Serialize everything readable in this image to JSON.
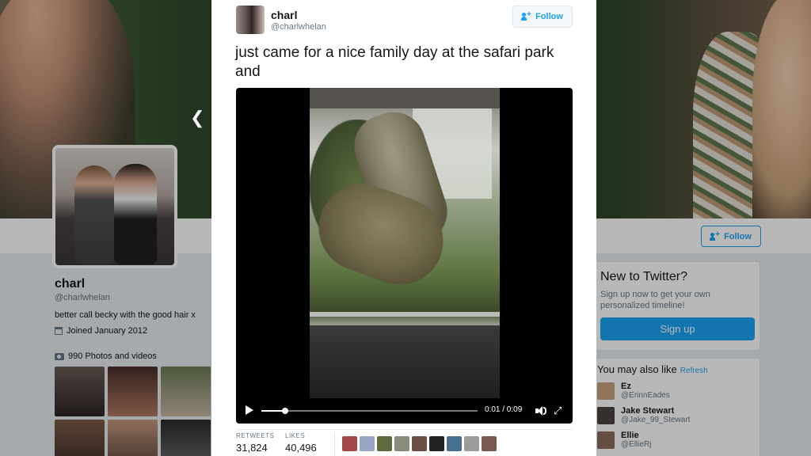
{
  "profile": {
    "name": "charl",
    "handle": "@charlwhelan",
    "bio": "better call becky with the good hair x",
    "joined": "Joined January 2012",
    "photos": "990 Photos and videos",
    "follow_label": "Follow"
  },
  "sidebar": {
    "new_title": "New to Twitter?",
    "new_subtitle": "Sign up now to get your own personalized timeline!",
    "signup_label": "Sign up",
    "wtf_title": "You may also like",
    "refresh_label": "Refresh",
    "users": [
      {
        "name": "Ez",
        "handle": "@ErinnEades",
        "color": "#c9a27a"
      },
      {
        "name": "Jake Stewart",
        "handle": "@Jake_99_Stewart",
        "color": "#4b4541"
      },
      {
        "name": "Ellie",
        "handle": "@EllieRj",
        "color": "#8b6c5c"
      }
    ]
  },
  "tweet": {
    "author_name": "charl",
    "author_handle": "@charlwhelan",
    "follow_label": "Follow",
    "text": "just came for a nice family day at the safari park and",
    "video": {
      "time": "0:01 / 0:09",
      "progress": 0.11
    },
    "retweets_label": "RETWEETS",
    "retweets": "31,824",
    "likes_label": "LIKES",
    "likes": "40,496"
  },
  "colors": {
    "accent": "#1da1f2",
    "text": "#14171a",
    "muted": "#657786"
  },
  "icons": {
    "prev": "chevron-left-icon",
    "calendar": "calendar-icon",
    "camera": "camera-icon",
    "follow": "person-plus-icon",
    "play": "play-icon",
    "volume": "volume-icon",
    "fullscreen": "fullscreen-icon"
  }
}
